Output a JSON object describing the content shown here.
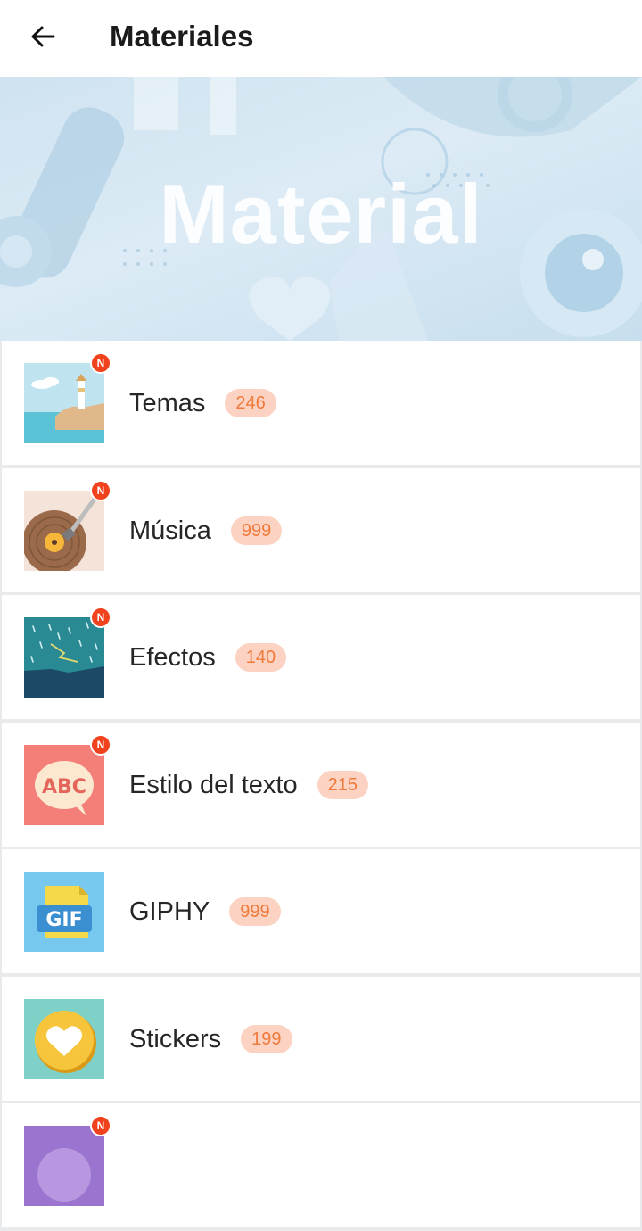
{
  "header": {
    "title": "Materiales"
  },
  "banner": {
    "text": "Material"
  },
  "items": [
    {
      "label": "Temas",
      "count": "246",
      "is_new": true,
      "icon": "lighthouse-icon",
      "badge": "N"
    },
    {
      "label": "Música",
      "count": "999",
      "is_new": true,
      "icon": "vinyl-record-icon",
      "badge": "N"
    },
    {
      "label": "Efectos",
      "count": "140",
      "is_new": true,
      "icon": "rain-lightning-icon",
      "badge": "N"
    },
    {
      "label": "Estilo del texto",
      "count": "215",
      "is_new": true,
      "icon": "abc-speech-bubble-icon",
      "badge": "N"
    },
    {
      "label": "GIPHY",
      "count": "999",
      "is_new": false,
      "icon": "gif-file-icon"
    },
    {
      "label": "Stickers",
      "count": "199",
      "is_new": false,
      "icon": "heart-sticker-icon"
    },
    {
      "label": "",
      "count": "",
      "is_new": true,
      "icon": "purple-partial-icon",
      "badge": "N"
    }
  ],
  "colors": {
    "badge_new": "#f0421c",
    "count_bg": "#fcd3c3",
    "count_text": "#f07a3a"
  }
}
